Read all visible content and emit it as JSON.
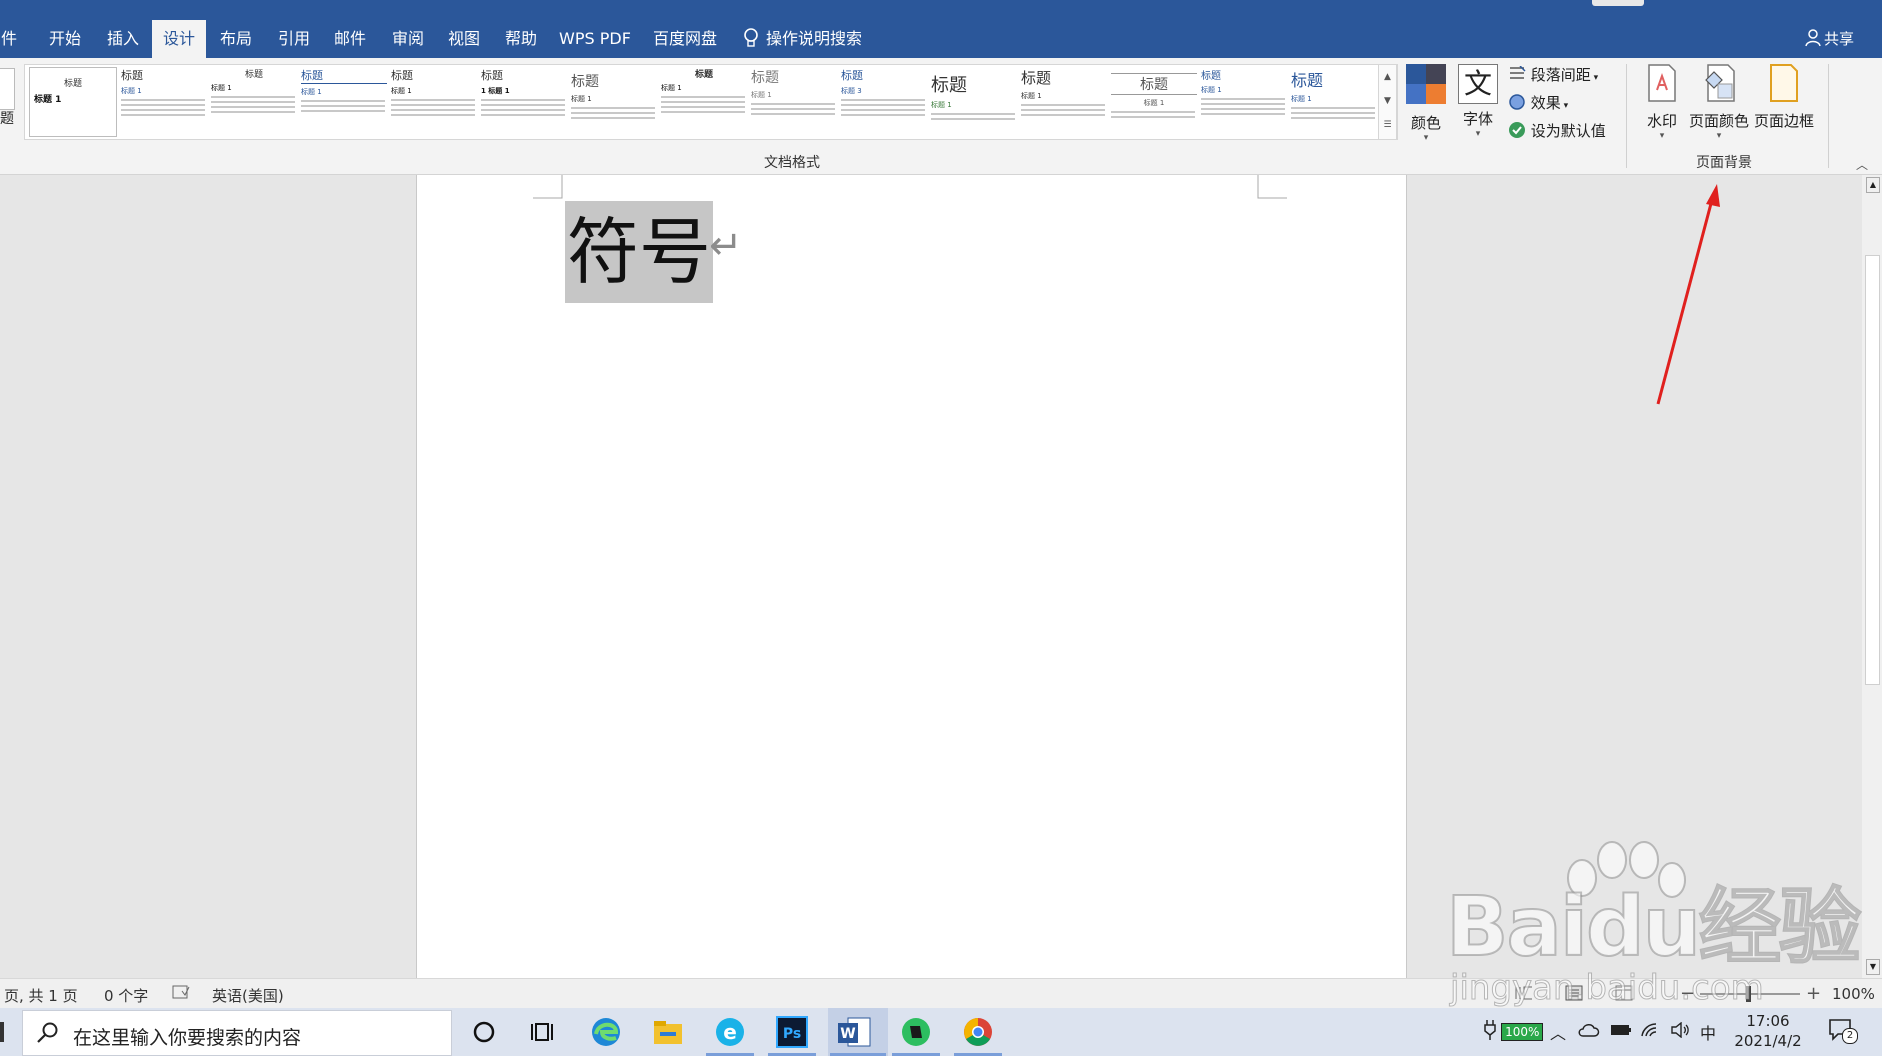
{
  "tabs": [
    "件",
    "开始",
    "插入",
    "设计",
    "布局",
    "引用",
    "邮件",
    "审阅",
    "视图",
    "帮助",
    "WPS PDF",
    "百度网盘"
  ],
  "active_tab": "设计",
  "tell_me": "操作说明搜索",
  "share": "共享",
  "ribbon": {
    "left_cut_label": "题",
    "gallery_group_label": "文档格式",
    "gallery": [
      {
        "title": "标题",
        "sub": "标题 1"
      },
      {
        "title": "标题",
        "sub": "标题 1"
      },
      {
        "title": "标题",
        "sub": "标题 1"
      },
      {
        "title": "标题",
        "sub": "标题 1"
      },
      {
        "title": "标题",
        "sub": "标题 1"
      },
      {
        "title": "标题",
        "sub": "1 标题 1"
      },
      {
        "title": "标题",
        "sub": "标题 1"
      },
      {
        "title": "标题",
        "sub": "标题 1"
      },
      {
        "title": "标题",
        "sub": "标题 1"
      },
      {
        "title": "标题",
        "sub": "标题 3"
      },
      {
        "title": "标题",
        "sub": "标题 1"
      },
      {
        "title": "标题",
        "sub": "标题 1"
      },
      {
        "title": "标题",
        "sub": "标题 1"
      },
      {
        "title": "标题",
        "sub": "标题 1"
      },
      {
        "title": "标题",
        "sub": "标题 1"
      }
    ],
    "colors_label": "颜色",
    "fonts_label": "字体",
    "fonts_glyph": "文",
    "para_spacing_label": "段落间距",
    "effects_label": "效果",
    "set_default_label": "设为默认值",
    "watermark_label": "水印",
    "page_color_label": "页面颜色",
    "page_border_label": "页面边框",
    "page_bg_group_label": "页面背景"
  },
  "document": {
    "text": "符号",
    "para_mark": "↵"
  },
  "status": {
    "page": "页, 共 1 页",
    "words": "0 个字",
    "language": "英语(美国)",
    "zoom": "100%"
  },
  "taskbar": {
    "search_placeholder": "在这里输入你要搜索的内容",
    "battery": "100%",
    "ime": "中",
    "time": "17:06",
    "date": "2021/4/2",
    "notification_count": "2"
  },
  "watermark": {
    "brand": "Baidu经验",
    "url": "jingyan.baidu.com"
  },
  "colors": {
    "word_blue": "#2b579a",
    "annotation_red": "#e0201e"
  }
}
